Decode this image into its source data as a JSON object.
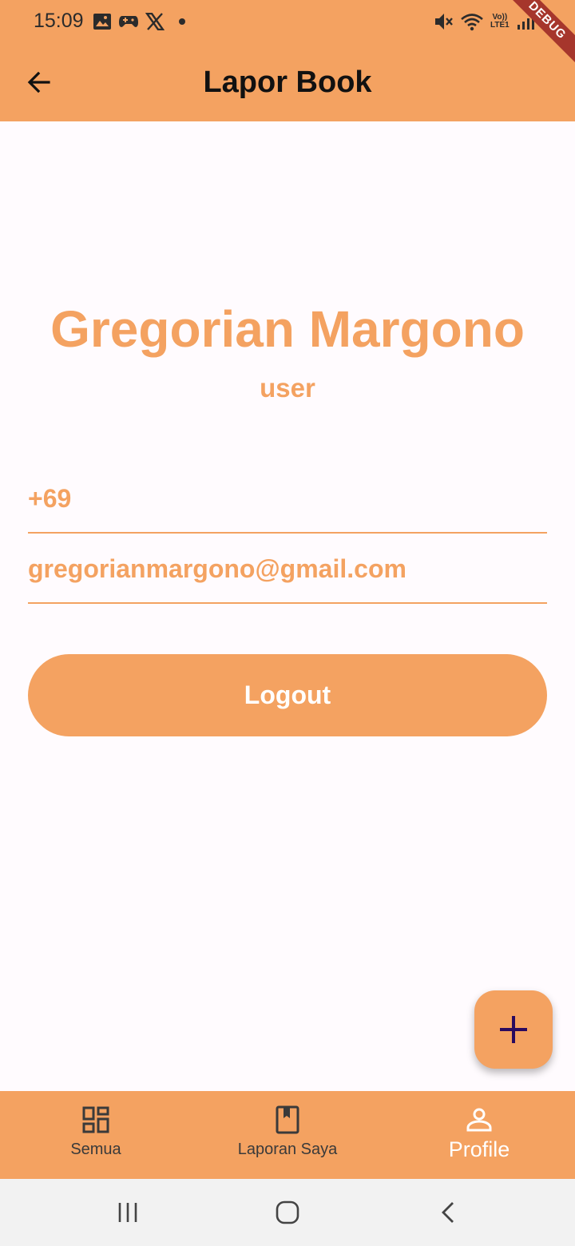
{
  "status_bar": {
    "time": "15:09",
    "volte_top": "Vo))",
    "volte_bottom": "LTE1"
  },
  "debug_banner": "DEBUG",
  "appbar": {
    "title": "Lapor Book"
  },
  "profile": {
    "name": "Gregorian Margono",
    "role": "user",
    "phone": "+69",
    "email": "gregorianmargono@gmail.com"
  },
  "actions": {
    "logout_label": "Logout"
  },
  "bottom_nav": {
    "items": [
      {
        "label": "Semua",
        "icon": "dashboard-icon",
        "active": false
      },
      {
        "label": "Laporan Saya",
        "icon": "book-icon",
        "active": false
      },
      {
        "label": "Profile",
        "icon": "person-icon",
        "active": true
      }
    ]
  },
  "colors": {
    "primary": "#f4a261",
    "background": "#fffbfe",
    "fab_icon": "#2a0a5e",
    "banner": "#a6362c"
  }
}
